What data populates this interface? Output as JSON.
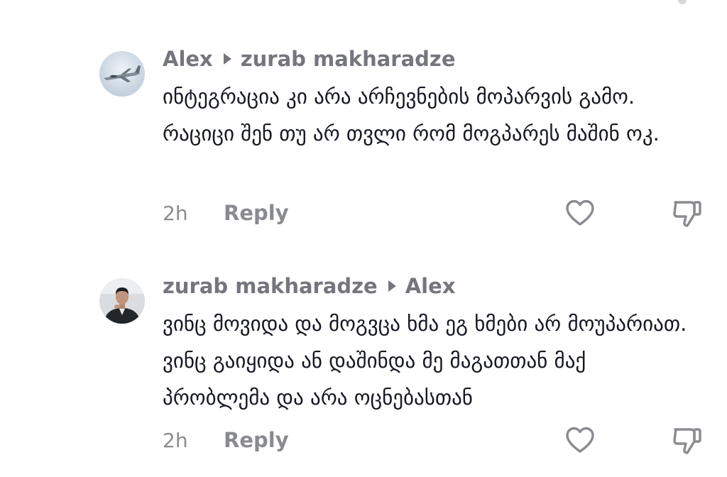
{
  "comments": [
    {
      "author": "Alex",
      "reply_to": "zurab makharadze",
      "text": "ინტეგრაცია კი არა არჩევნების მოპარვის გამო. რაციცი შენ თუ არ თვლი რომ მოგპარეს მაშინ ოკ.",
      "time": "2h",
      "reply_label": "Reply",
      "avatar_icon": "fighter-jet-avatar"
    },
    {
      "author": "zurab makharadze",
      "reply_to": "Alex",
      "text": "ვინც მოვიდა და მოგვცა ხმა ეგ ხმები არ მოუპარიათ. ვინც გაიყიდა ან დაშინდა მე მაგათთან მაქ პრობლემა და არა ოცნებასთან",
      "time": "2h",
      "reply_label": "Reply",
      "avatar_icon": "man-in-suit-avatar"
    }
  ],
  "icons": {
    "like": "heart-outline-icon",
    "dislike": "thumbs-down-outline-icon"
  },
  "colors": {
    "meta_gray": "#75767d",
    "text": "#161823",
    "icon_gray": "#8a8b91"
  }
}
